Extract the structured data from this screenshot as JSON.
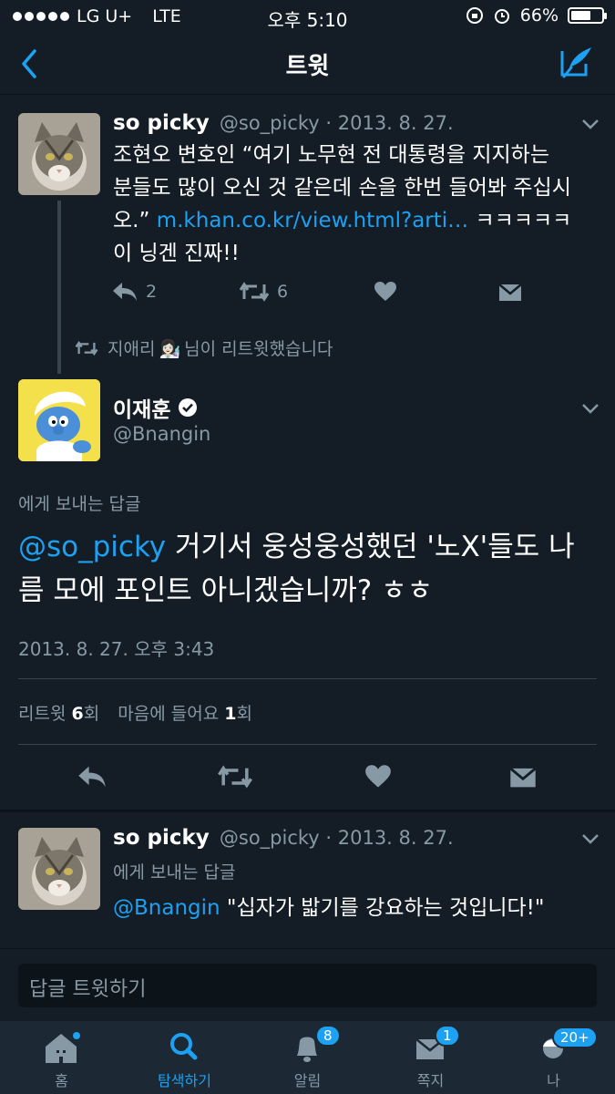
{
  "status": {
    "carrier": "LG U+",
    "network": "LTE",
    "time": "오후 5:10",
    "battery": "66%",
    "battery_level": 0.66
  },
  "nav": {
    "title": "트윗"
  },
  "tweet1": {
    "name": "so picky",
    "meta": "@so_picky · 2013. 8. 27.",
    "text_line1": "조현오 변호인 “여기 노무현 전 대통령을 지지하는",
    "text_line2": "분들도 많이 오신 것 같은데 손을 한번 들어봐 주십시",
    "text_line3_prefix": "오.” ",
    "link": "m.khan.co.kr/view.html?arti…",
    "text_line3_suffix": " ㅋㅋㅋㅋㅋ",
    "text_line4": "이 닝겐 진짜!!",
    "reply_count": "2",
    "retweet_count": "6"
  },
  "retweet_notice": {
    "user": "지애리",
    "emoji": "👩🏻‍🔬",
    "suffix": "님이 리트윗했습니다"
  },
  "main": {
    "name": "이재훈",
    "handle": "@Bnangin",
    "reply_to_label": "에게 보내는 답글",
    "mention": "@so_picky",
    "text_part1": " 거기서 웅성웅성했던 '노X'들도 나",
    "text_part2": "름 모에 포인트 아니겠습니까? ㅎㅎ",
    "timestamp": "2013. 8. 27. 오후 3:43",
    "retweet_label": "리트윗 ",
    "retweet_count": "6",
    "retweet_unit": "회",
    "like_label": "마음에 들어요 ",
    "like_count": "1",
    "like_unit": "회"
  },
  "tweet3": {
    "name": "so picky",
    "meta": "@so_picky · 2013. 8. 27.",
    "reply_to_label": "에게 보내는 답글",
    "mention": "@Bnangin",
    "text": " \"십자가 밟기를 강요하는 것입니다!\""
  },
  "reply_bar": {
    "placeholder": "답글 트윗하기"
  },
  "tabs": [
    {
      "label": "홈",
      "icon": "home-icon"
    },
    {
      "label": "탐색하기",
      "icon": "search-icon"
    },
    {
      "label": "알림",
      "icon": "bell-icon",
      "badge": "8"
    },
    {
      "label": "쪽지",
      "icon": "envelope-icon",
      "badge": "1"
    },
    {
      "label": "나",
      "icon": "profile-icon",
      "badge": "20+"
    }
  ],
  "colors": {
    "background": "#141d26",
    "accent": "#1da1f2",
    "muted": "#8899a6",
    "tabbar": "#1c2834"
  }
}
